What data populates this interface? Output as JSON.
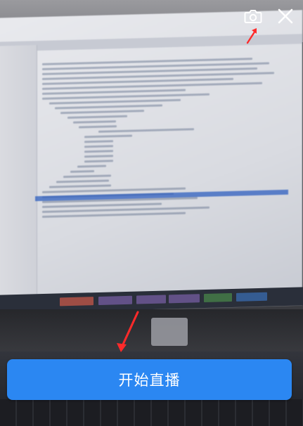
{
  "controls": {
    "start_button_label": "开始直播",
    "camera_icon": "camera-switch-icon",
    "close_icon": "close-icon"
  },
  "colors": {
    "primary": "#2b87f2",
    "annotation_arrow": "#ff2a2a",
    "icon": "#ffffff"
  }
}
